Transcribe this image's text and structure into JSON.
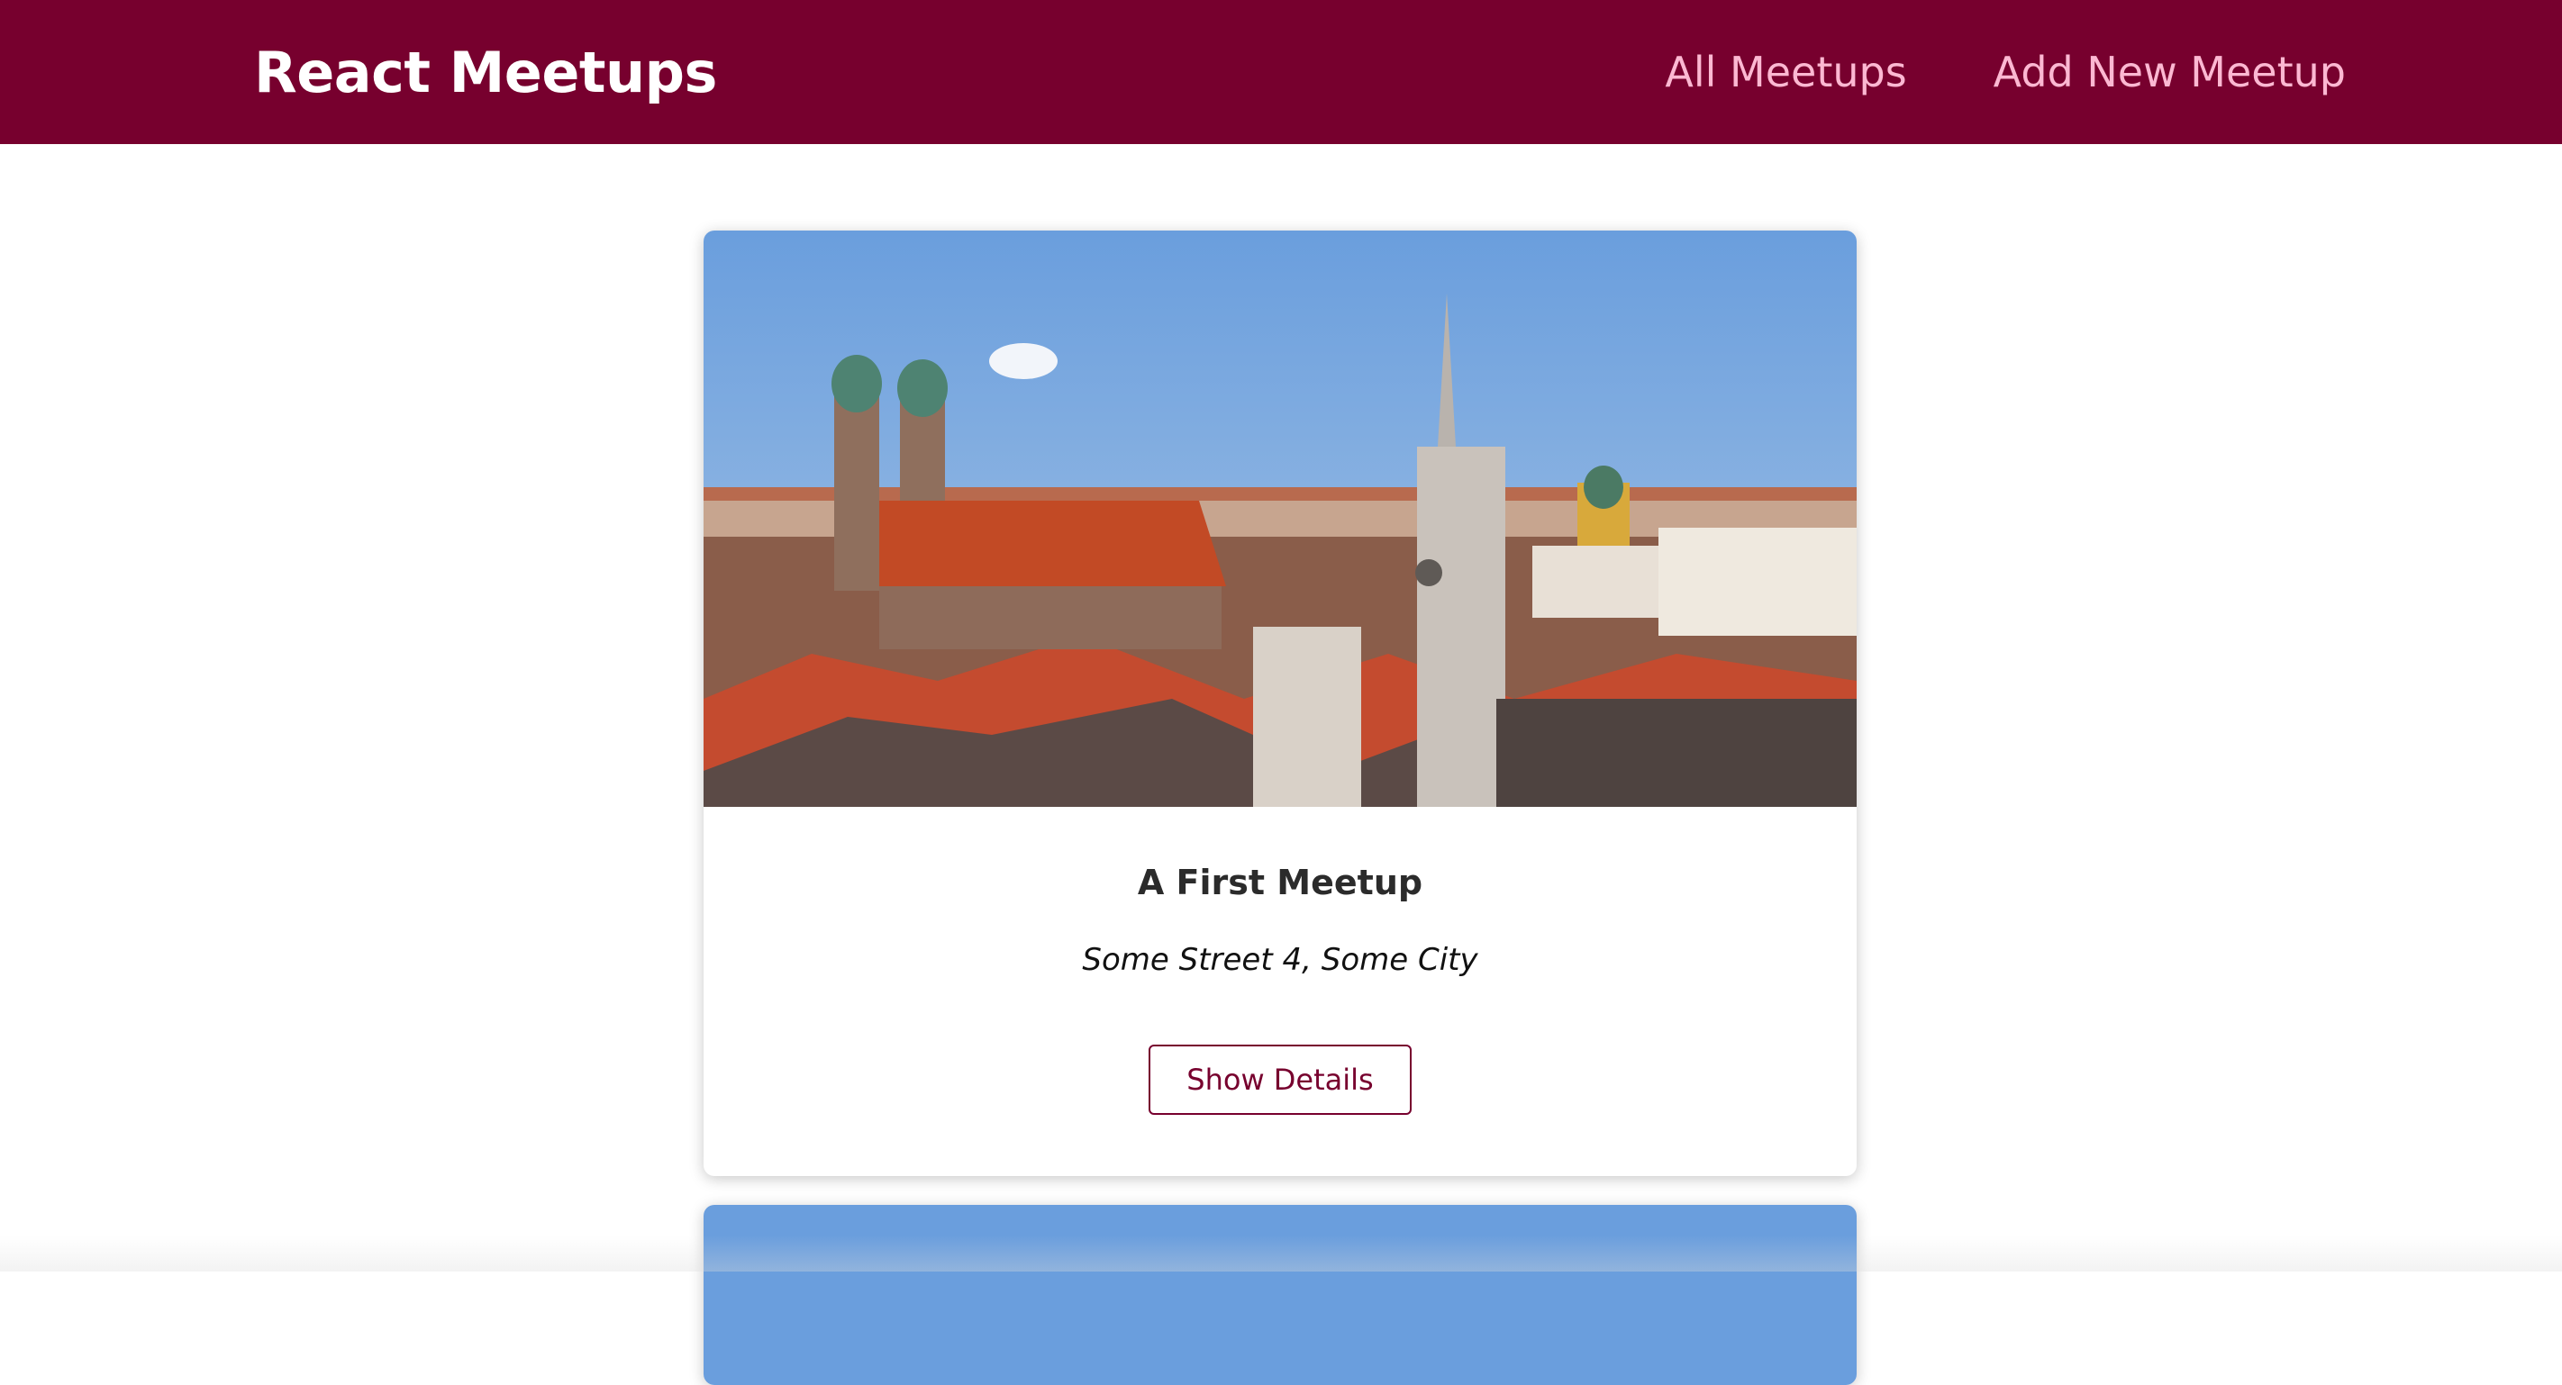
{
  "app": {
    "title": "React Meetups"
  },
  "nav": {
    "items": [
      {
        "label": "All Meetups"
      },
      {
        "label": "Add New Meetup"
      }
    ]
  },
  "meetups": [
    {
      "title": "A First Meetup",
      "address": "Some Street 4, Some City",
      "button_label": "Show Details"
    }
  ],
  "colors": {
    "brand": "#77002e",
    "nav_link": "#fcb8d2",
    "sky": "#6fa0dc"
  }
}
